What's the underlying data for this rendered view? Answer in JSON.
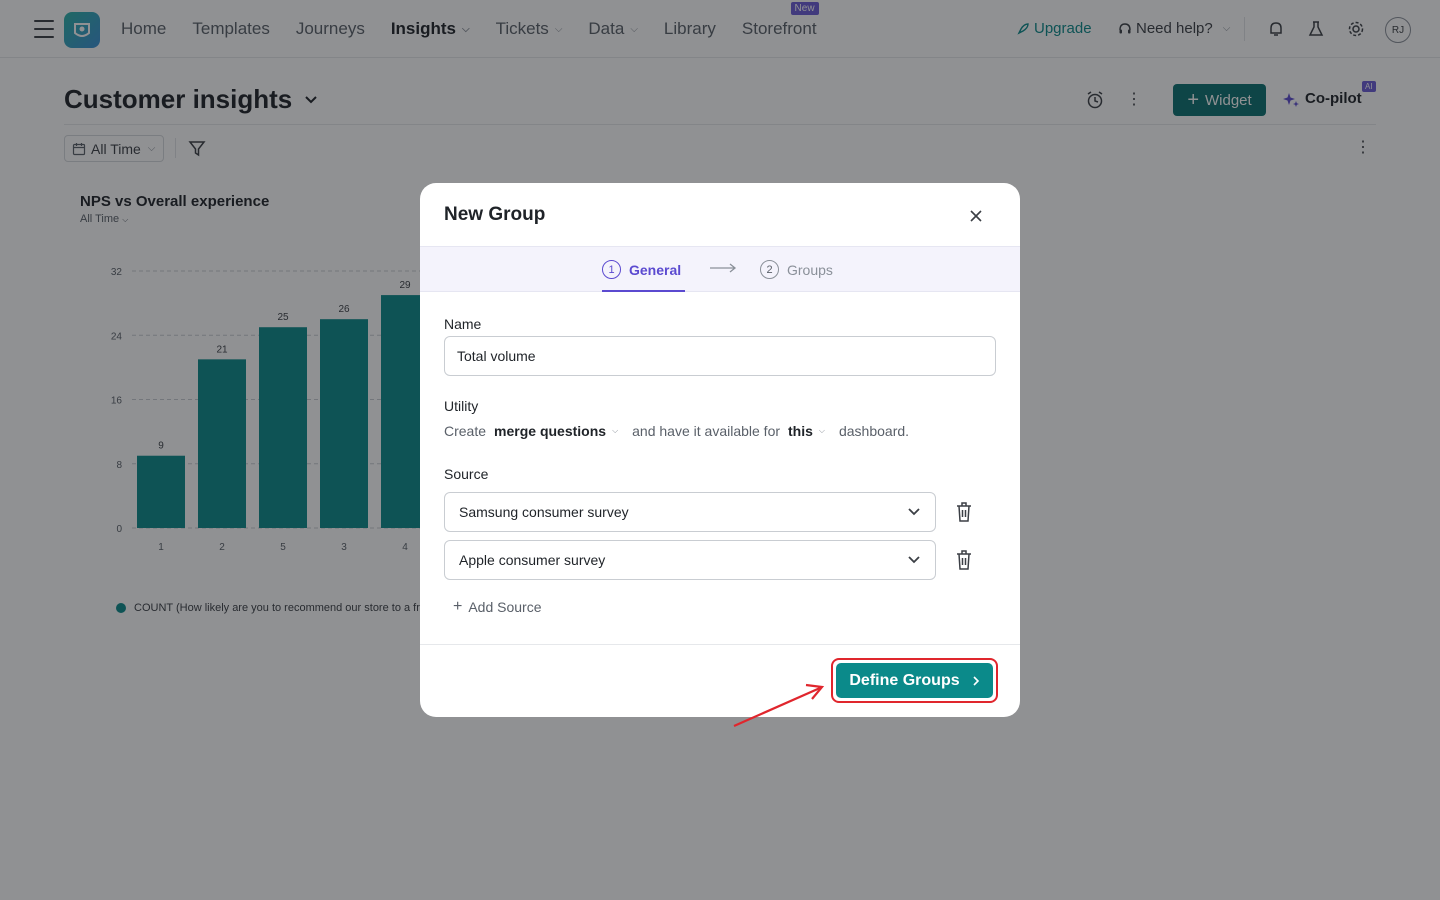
{
  "nav": {
    "items": [
      {
        "label": "Home",
        "active": false,
        "dropdown": false
      },
      {
        "label": "Templates",
        "active": false,
        "dropdown": false
      },
      {
        "label": "Journeys",
        "active": false,
        "dropdown": false
      },
      {
        "label": "Insights",
        "active": true,
        "dropdown": true
      },
      {
        "label": "Tickets",
        "active": false,
        "dropdown": true
      },
      {
        "label": "Data",
        "active": false,
        "dropdown": true
      },
      {
        "label": "Library",
        "active": false,
        "dropdown": false
      },
      {
        "label": "Storefront",
        "active": false,
        "dropdown": false,
        "badge": "New"
      }
    ],
    "upgrade_label": "Upgrade",
    "help_label": "Need help?",
    "avatar_initials": "RJ"
  },
  "page": {
    "title": "Customer insights",
    "widget_label": "Widget",
    "copilot_label": "Co-pilot",
    "copilot_badge": "AI",
    "filter_label": "All Time"
  },
  "card": {
    "title": "NPS vs Overall experience",
    "subtitle": "All Time",
    "legend": "COUNT (How likely are you to recommend our store to a fr"
  },
  "chart_data": {
    "type": "bar",
    "categories": [
      "1",
      "2",
      "5",
      "3",
      "4"
    ],
    "values": [
      9,
      21,
      25,
      26,
      29
    ],
    "ylim": [
      0,
      32
    ],
    "yticks": [
      0,
      8,
      16,
      24,
      32
    ],
    "grid": true,
    "bar_color": "#0b8a8a"
  },
  "modal": {
    "title": "New Group",
    "steps": [
      {
        "num": "1",
        "label": "General",
        "active": true
      },
      {
        "num": "2",
        "label": "Groups",
        "active": false
      }
    ],
    "name_label": "Name",
    "name_value": "Total volume",
    "utility_label": "Utility",
    "utility_create": "Create",
    "utility_action": "merge questions",
    "utility_middle": "and have it available for",
    "utility_scope": "this",
    "utility_end": "dashboard.",
    "source_label": "Source",
    "sources": [
      "Samsung consumer survey",
      "Apple consumer survey"
    ],
    "add_source_label": "Add Source",
    "define_label": "Define Groups"
  },
  "colors": {
    "accent": "#0b8a8a",
    "step_active": "#5b4ad0",
    "highlight": "#e0262d"
  }
}
